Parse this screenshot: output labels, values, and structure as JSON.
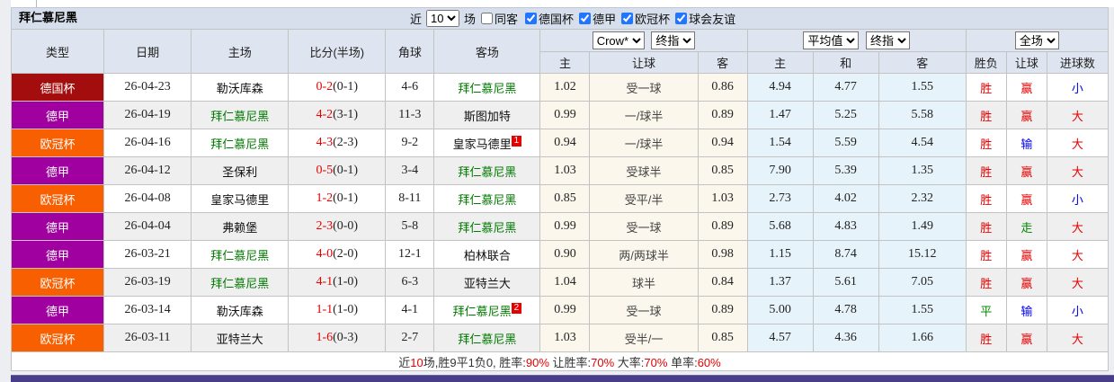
{
  "header": {
    "title": "拜仁慕尼黑",
    "near_label": "近",
    "near_value": "10",
    "matches_label": "场",
    "same_away_label": "同客",
    "same_away_checked": false,
    "competitions": [
      {
        "label": "德国杯",
        "checked": true
      },
      {
        "label": "德甲",
        "checked": true
      },
      {
        "label": "欧冠杯",
        "checked": true
      },
      {
        "label": "球会友谊",
        "checked": true
      }
    ]
  },
  "columns": {
    "left": [
      "类型",
      "日期",
      "主场",
      "比分(半场)",
      "角球",
      "客场"
    ],
    "odds_group_selects": [
      "Crow*",
      "终指"
    ],
    "avg_group_selects": [
      "平均值",
      "终指"
    ],
    "scope_select": "全场",
    "sub": [
      "主",
      "让球",
      "客",
      "主",
      "和",
      "客",
      "胜负",
      "让球",
      "进球数"
    ]
  },
  "league_colors": {
    "德国杯": "#a30d0d",
    "德甲": "#9f009f",
    "欧冠杯": "#f85f00"
  },
  "rows": [
    {
      "league": "德国杯",
      "date": "26-04-23",
      "home": {
        "name": "勒沃库森",
        "focus": false,
        "sup": ""
      },
      "score": {
        "ft": "0-2",
        "ht": "(0-1)"
      },
      "corners": "4-6",
      "away": {
        "name": "拜仁慕尼黑",
        "focus": true,
        "sup": ""
      },
      "crow": [
        "1.02",
        "受一球",
        "0.86"
      ],
      "avg": [
        "4.94",
        "4.77",
        "1.55"
      ],
      "outcome": [
        {
          "t": "胜",
          "c": "red"
        },
        {
          "t": "赢",
          "c": "red"
        },
        {
          "t": "小",
          "c": "blue"
        }
      ]
    },
    {
      "league": "德甲",
      "date": "26-04-19",
      "home": {
        "name": "拜仁慕尼黑",
        "focus": true,
        "sup": ""
      },
      "score": {
        "ft": "4-2",
        "ht": "(3-1)"
      },
      "corners": "11-3",
      "away": {
        "name": "斯图加特",
        "focus": false,
        "sup": ""
      },
      "crow": [
        "0.99",
        "一/球半",
        "0.89"
      ],
      "avg": [
        "1.47",
        "5.25",
        "5.58"
      ],
      "outcome": [
        {
          "t": "胜",
          "c": "red"
        },
        {
          "t": "赢",
          "c": "red"
        },
        {
          "t": "大",
          "c": "red"
        }
      ]
    },
    {
      "league": "欧冠杯",
      "date": "26-04-16",
      "home": {
        "name": "拜仁慕尼黑",
        "focus": true,
        "sup": ""
      },
      "score": {
        "ft": "4-3",
        "ht": "(2-3)"
      },
      "corners": "9-2",
      "away": {
        "name": "皇家马德里",
        "focus": false,
        "sup": "1"
      },
      "crow": [
        "0.94",
        "一/球半",
        "0.94"
      ],
      "avg": [
        "1.54",
        "5.59",
        "4.54"
      ],
      "outcome": [
        {
          "t": "胜",
          "c": "red"
        },
        {
          "t": "输",
          "c": "blue"
        },
        {
          "t": "大",
          "c": "red"
        }
      ]
    },
    {
      "league": "德甲",
      "date": "26-04-12",
      "home": {
        "name": "圣保利",
        "focus": false,
        "sup": ""
      },
      "score": {
        "ft": "0-5",
        "ht": "(0-1)"
      },
      "corners": "3-4",
      "away": {
        "name": "拜仁慕尼黑",
        "focus": true,
        "sup": ""
      },
      "crow": [
        "1.03",
        "受球半",
        "0.85"
      ],
      "avg": [
        "7.90",
        "5.39",
        "1.35"
      ],
      "outcome": [
        {
          "t": "胜",
          "c": "red"
        },
        {
          "t": "赢",
          "c": "red"
        },
        {
          "t": "大",
          "c": "red"
        }
      ]
    },
    {
      "league": "欧冠杯",
      "date": "26-04-08",
      "home": {
        "name": "皇家马德里",
        "focus": false,
        "sup": ""
      },
      "score": {
        "ft": "1-2",
        "ht": "(0-1)"
      },
      "corners": "8-11",
      "away": {
        "name": "拜仁慕尼黑",
        "focus": true,
        "sup": ""
      },
      "crow": [
        "0.85",
        "受平/半",
        "1.03"
      ],
      "avg": [
        "2.73",
        "4.02",
        "2.32"
      ],
      "outcome": [
        {
          "t": "胜",
          "c": "red"
        },
        {
          "t": "赢",
          "c": "red"
        },
        {
          "t": "小",
          "c": "blue"
        }
      ]
    },
    {
      "league": "德甲",
      "date": "26-04-04",
      "home": {
        "name": "弗赖堡",
        "focus": false,
        "sup": ""
      },
      "score": {
        "ft": "2-3",
        "ht": "(0-0)"
      },
      "corners": "5-8",
      "away": {
        "name": "拜仁慕尼黑",
        "focus": true,
        "sup": ""
      },
      "crow": [
        "0.99",
        "受一球",
        "0.89"
      ],
      "avg": [
        "5.68",
        "4.83",
        "1.49"
      ],
      "outcome": [
        {
          "t": "胜",
          "c": "red"
        },
        {
          "t": "走",
          "c": "green"
        },
        {
          "t": "大",
          "c": "red"
        }
      ]
    },
    {
      "league": "德甲",
      "date": "26-03-21",
      "home": {
        "name": "拜仁慕尼黑",
        "focus": true,
        "sup": ""
      },
      "score": {
        "ft": "4-0",
        "ht": "(2-0)"
      },
      "corners": "12-1",
      "away": {
        "name": "柏林联合",
        "focus": false,
        "sup": ""
      },
      "crow": [
        "0.90",
        "两/两球半",
        "0.98"
      ],
      "avg": [
        "1.15",
        "8.74",
        "15.12"
      ],
      "outcome": [
        {
          "t": "胜",
          "c": "red"
        },
        {
          "t": "赢",
          "c": "red"
        },
        {
          "t": "大",
          "c": "red"
        }
      ]
    },
    {
      "league": "欧冠杯",
      "date": "26-03-19",
      "home": {
        "name": "拜仁慕尼黑",
        "focus": true,
        "sup": ""
      },
      "score": {
        "ft": "4-1",
        "ht": "(1-0)"
      },
      "corners": "6-3",
      "away": {
        "name": "亚特兰大",
        "focus": false,
        "sup": ""
      },
      "crow": [
        "1.04",
        "球半",
        "0.84"
      ],
      "avg": [
        "1.37",
        "5.61",
        "7.05"
      ],
      "outcome": [
        {
          "t": "胜",
          "c": "red"
        },
        {
          "t": "赢",
          "c": "red"
        },
        {
          "t": "大",
          "c": "red"
        }
      ]
    },
    {
      "league": "德甲",
      "date": "26-03-14",
      "home": {
        "name": "勒沃库森",
        "focus": false,
        "sup": ""
      },
      "score": {
        "ft": "1-1",
        "ht": "(1-0)"
      },
      "corners": "4-1",
      "away": {
        "name": "拜仁慕尼黑",
        "focus": true,
        "sup": "2"
      },
      "crow": [
        "0.99",
        "受一球",
        "0.89"
      ],
      "avg": [
        "5.00",
        "4.78",
        "1.55"
      ],
      "outcome": [
        {
          "t": "平",
          "c": "green"
        },
        {
          "t": "输",
          "c": "blue"
        },
        {
          "t": "小",
          "c": "blue"
        }
      ]
    },
    {
      "league": "欧冠杯",
      "date": "26-03-11",
      "home": {
        "name": "亚特兰大",
        "focus": false,
        "sup": ""
      },
      "score": {
        "ft": "1-6",
        "ht": "(0-3)"
      },
      "corners": "2-7",
      "away": {
        "name": "拜仁慕尼黑",
        "focus": true,
        "sup": ""
      },
      "crow": [
        "1.03",
        "受半/一",
        "0.85"
      ],
      "avg": [
        "4.57",
        "4.36",
        "1.66"
      ],
      "outcome": [
        {
          "t": "胜",
          "c": "red"
        },
        {
          "t": "赢",
          "c": "red"
        },
        {
          "t": "大",
          "c": "red"
        }
      ]
    }
  ],
  "summary_segments": [
    {
      "t": "近",
      "red": false
    },
    {
      "t": "10",
      "red": true
    },
    {
      "t": "场,胜9平1负0, 胜率:",
      "red": false
    },
    {
      "t": "90%",
      "red": true
    },
    {
      "t": " 让胜率:",
      "red": false
    },
    {
      "t": "70%",
      "red": true
    },
    {
      "t": " 大率:",
      "red": false
    },
    {
      "t": "70%",
      "red": true
    },
    {
      "t": " 单率:",
      "red": false
    },
    {
      "t": "60%",
      "red": true
    }
  ]
}
